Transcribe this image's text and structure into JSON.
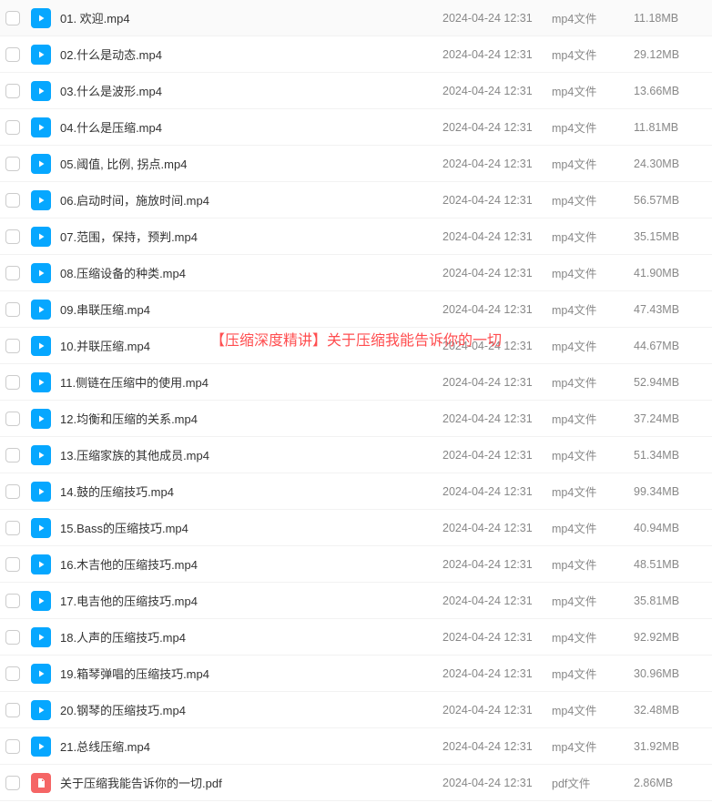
{
  "watermark": "【压缩深度精讲】关于压缩我能告诉你的一切",
  "files": [
    {
      "name": "01. 欢迎.mp4",
      "date": "2024-04-24 12:31",
      "type": "mp4文件",
      "size": "11.18MB",
      "kind": "mp4"
    },
    {
      "name": "02.什么是动态.mp4",
      "date": "2024-04-24 12:31",
      "type": "mp4文件",
      "size": "29.12MB",
      "kind": "mp4"
    },
    {
      "name": "03.什么是波形.mp4",
      "date": "2024-04-24 12:31",
      "type": "mp4文件",
      "size": "13.66MB",
      "kind": "mp4"
    },
    {
      "name": "04.什么是压缩.mp4",
      "date": "2024-04-24 12:31",
      "type": "mp4文件",
      "size": "11.81MB",
      "kind": "mp4"
    },
    {
      "name": "05.阈值, 比例, 拐点.mp4",
      "date": "2024-04-24 12:31",
      "type": "mp4文件",
      "size": "24.30MB",
      "kind": "mp4"
    },
    {
      "name": "06.启动时间，施放时间.mp4",
      "date": "2024-04-24 12:31",
      "type": "mp4文件",
      "size": "56.57MB",
      "kind": "mp4"
    },
    {
      "name": "07.范围，保持，预判.mp4",
      "date": "2024-04-24 12:31",
      "type": "mp4文件",
      "size": "35.15MB",
      "kind": "mp4"
    },
    {
      "name": "08.压缩设备的种类.mp4",
      "date": "2024-04-24 12:31",
      "type": "mp4文件",
      "size": "41.90MB",
      "kind": "mp4"
    },
    {
      "name": "09.串联压缩.mp4",
      "date": "2024-04-24 12:31",
      "type": "mp4文件",
      "size": "47.43MB",
      "kind": "mp4"
    },
    {
      "name": "10.并联压缩.mp4",
      "date": "2024-04-24 12:31",
      "type": "mp4文件",
      "size": "44.67MB",
      "kind": "mp4"
    },
    {
      "name": "11.侧链在压缩中的使用.mp4",
      "date": "2024-04-24 12:31",
      "type": "mp4文件",
      "size": "52.94MB",
      "kind": "mp4"
    },
    {
      "name": "12.均衡和压缩的关系.mp4",
      "date": "2024-04-24 12:31",
      "type": "mp4文件",
      "size": "37.24MB",
      "kind": "mp4"
    },
    {
      "name": "13.压缩家族的其他成员.mp4",
      "date": "2024-04-24 12:31",
      "type": "mp4文件",
      "size": "51.34MB",
      "kind": "mp4"
    },
    {
      "name": "14.鼓的压缩技巧.mp4",
      "date": "2024-04-24 12:31",
      "type": "mp4文件",
      "size": "99.34MB",
      "kind": "mp4"
    },
    {
      "name": "15.Bass的压缩技巧.mp4",
      "date": "2024-04-24 12:31",
      "type": "mp4文件",
      "size": "40.94MB",
      "kind": "mp4"
    },
    {
      "name": "16.木吉他的压缩技巧.mp4",
      "date": "2024-04-24 12:31",
      "type": "mp4文件",
      "size": "48.51MB",
      "kind": "mp4"
    },
    {
      "name": "17.电吉他的压缩技巧.mp4",
      "date": "2024-04-24 12:31",
      "type": "mp4文件",
      "size": "35.81MB",
      "kind": "mp4"
    },
    {
      "name": "18.人声的压缩技巧.mp4",
      "date": "2024-04-24 12:31",
      "type": "mp4文件",
      "size": "92.92MB",
      "kind": "mp4"
    },
    {
      "name": "19.箱琴弹唱的压缩技巧.mp4",
      "date": "2024-04-24 12:31",
      "type": "mp4文件",
      "size": "30.96MB",
      "kind": "mp4"
    },
    {
      "name": "20.钢琴的压缩技巧.mp4",
      "date": "2024-04-24 12:31",
      "type": "mp4文件",
      "size": "32.48MB",
      "kind": "mp4"
    },
    {
      "name": "21.总线压缩.mp4",
      "date": "2024-04-24 12:31",
      "type": "mp4文件",
      "size": "31.92MB",
      "kind": "mp4"
    },
    {
      "name": "关于压缩我能告诉你的一切.pdf",
      "date": "2024-04-24 12:31",
      "type": "pdf文件",
      "size": "2.86MB",
      "kind": "pdf"
    }
  ]
}
